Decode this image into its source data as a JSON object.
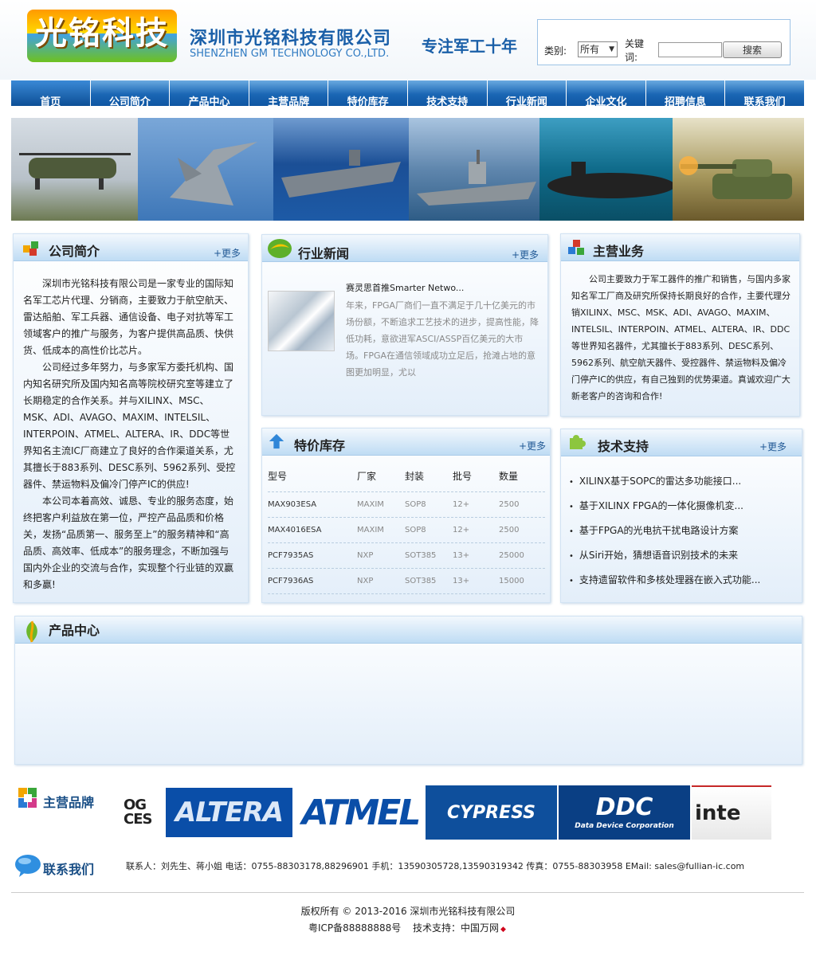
{
  "header": {
    "logo_text": "光铭科技",
    "company_cn": "深圳市光铭科技有限公司",
    "company_en": "SHENZHEN GM TECHNOLOGY CO.,LTD.",
    "slogan": "专注军工十年",
    "search": {
      "category_label": "类别:",
      "category_value": "所有",
      "keyword_label_1": "关键",
      "keyword_label_2": "词:",
      "button_label": "搜索"
    }
  },
  "nav": [
    "首页",
    "公司简介",
    "产品中心",
    "主营品牌",
    "特价库存",
    "技术支持",
    "行业新闻",
    "企业文化",
    "招聘信息",
    "联系我们"
  ],
  "about": {
    "title": "公司简介",
    "more": "+更多",
    "paragraphs": [
      "深圳市光铭科技有限公司是一家专业的国际知名军工芯片代理、分销商，主要致力于航空航天、雷达船舶、军工兵器、通信设备、电子对抗等军工领域客户的推广与服务，为客户提供高品质、快供货、低成本的高性价比芯片。",
      "公司经过多年努力，与多家军方委托机构、国内知名研究所及国内知名高等院校研究室等建立了长期稳定的合作关系。并与XILINX、MSC、MSK、ADI、AVAGO、MAXIM、INTELSIL、INTERPOIN、ATMEL、ALTERA、IR、DDC等世界知名主流IC厂商建立了良好的合作渠道关系，尤其擅长于883系列、DESC系列、5962系列、受控器件、禁运物料及偏冷门停产IC的供应!",
      "本公司本着高效、诚恳、专业的服务态度，始终把客户利益放在第一位，严控产品品质和价格关，发扬“品质第一、服务至上”的服务精神和“高品质、高效率、低成本”的服务理念，不断加强与国内外企业的交流与合作，实现整个行业链的双赢和多赢!"
    ]
  },
  "news": {
    "title": "行业新闻",
    "more": "+更多",
    "item_title": "赛灵思首推Smarter Netwo...",
    "item_summary": "年来，FPGA厂商们一直不满足于几十亿美元的市场份额，不断追求工艺技术的进步，提高性能，降低功耗，意欲进军ASCI/ASSP百亿美元的大市场。FPGA在通信领域成功立足后，抢滩占地的意图更加明显，尤以"
  },
  "business": {
    "title": "主营业务",
    "text": "公司主要致力于军工器件的推广和销售，与国内多家知名军工厂商及研究所保持长期良好的合作，主要代理分销XILINX、MSC、MSK、ADI、AVAGO、MAXIM、INTELSIL、INTERPOIN、ATMEL、ALTERA、IR、DDC等世界知名器件，尤其擅长于883系列、DESC系列、5962系列、航空航天器件、受控器件、禁运物料及偏冷门停产IC的供应，有自己独到的优势渠道。真诚欢迎广大新老客户的咨询和合作!"
  },
  "stock": {
    "title": "特价库存",
    "more": "+更多",
    "headers": [
      "型号",
      "厂家",
      "封装",
      "批号",
      "数量"
    ],
    "rows": [
      [
        "MAX903ESA",
        "MAXIM",
        "SOP8",
        "12+",
        "2500"
      ],
      [
        "MAX4016ESA",
        "MAXIM",
        "SOP8",
        "12+",
        "2500"
      ],
      [
        "PCF7935AS",
        "NXP",
        "SOT385",
        "13+",
        "25000"
      ],
      [
        "PCF7936AS",
        "NXP",
        "SOT385",
        "13+",
        "15000"
      ]
    ]
  },
  "tech": {
    "title": "技术支持",
    "more": "+更多",
    "items": [
      "XILINX基于SOPC的雷达多功能接口...",
      "基于XILINX FPGA的一体化摄像机変...",
      "基于FPGA的光电抗干扰电路设计方案",
      "从Siri开始，猜想语音识别技术的未来",
      "支持遗留软件和多核处理器在嵌入式功能..."
    ]
  },
  "products": {
    "title": "产品中心"
  },
  "brands": {
    "title": "主营品牌",
    "logos": [
      "OG CES",
      "ALTERA",
      "ATMEL",
      "CYPRESS",
      "DDC",
      "Data Device Corporation",
      "inte"
    ]
  },
  "contact": {
    "title": "联系我们",
    "line": "联系人：刘先生、蒋小姐  电话：0755-88303178,88296901  手机：13590305728,13590319342  传真：0755-88303958  EMail: sales@fullian-ic.com"
  },
  "footer": {
    "copyright": "版权所有 © 2013-2016 深圳市光铭科技有限公司",
    "icp": "粤ICP备88888888号",
    "tech_support": "技术支持：中国万网"
  }
}
